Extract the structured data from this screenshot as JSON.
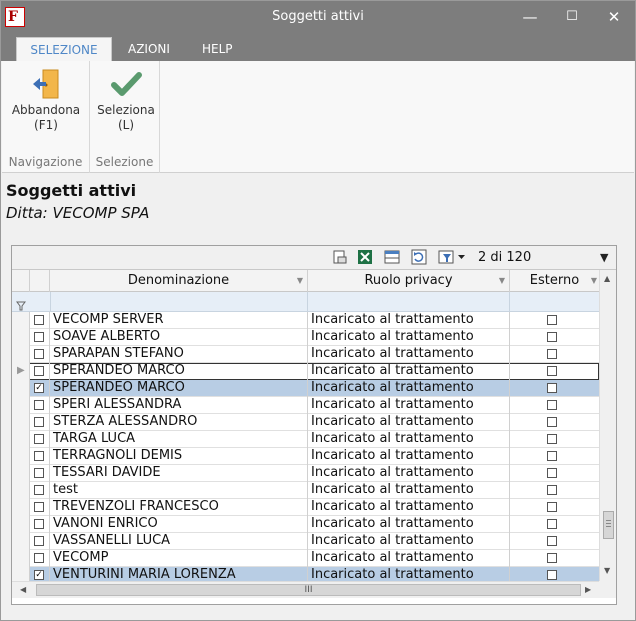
{
  "window": {
    "title": "Soggetti attivi",
    "app_icon": "F",
    "minimize": "—",
    "maximize": "☐",
    "close": "✕"
  },
  "ribbon": {
    "tabs": [
      {
        "label": "SELEZIONE"
      },
      {
        "label": "AZIONI"
      },
      {
        "label": "HELP"
      }
    ],
    "groups": [
      {
        "label": "Navigazione",
        "button": {
          "line1": "Abbandona",
          "line2": "(F1)",
          "icon": "exit-door-icon"
        }
      },
      {
        "label": "Selezione",
        "button": {
          "line1": "Seleziona",
          "line2": "(L)",
          "icon": "checkmark-icon"
        }
      }
    ]
  },
  "page": {
    "title": "Soggetti attivi",
    "subtitle": "Ditta: VECOMP SPA"
  },
  "grid": {
    "pager": "2 di 120",
    "toolbar_icons": [
      "print-preview-icon",
      "excel-export-icon",
      "columns-icon",
      "refresh-icon",
      "filter-settings-icon"
    ],
    "columns": [
      {
        "label": "Denominazione"
      },
      {
        "label": "Ruolo privacy"
      },
      {
        "label": "Esterno"
      }
    ],
    "rows": [
      {
        "name": "VECOMP SERVER",
        "role": "Incaricato al trattamento",
        "checked": false,
        "selected": false,
        "current": false
      },
      {
        "name": "SOAVE ALBERTO",
        "role": "Incaricato al trattamento",
        "checked": false,
        "selected": false,
        "current": false
      },
      {
        "name": "SPARAPAN STEFANO",
        "role": "Incaricato al trattamento",
        "checked": false,
        "selected": false,
        "current": false
      },
      {
        "name": "SPERANDEO MARCO",
        "role": "Incaricato al trattamento",
        "checked": false,
        "selected": false,
        "current": true
      },
      {
        "name": "SPERANDEO MARCO",
        "role": "Incaricato al trattamento",
        "checked": true,
        "selected": true,
        "current": false
      },
      {
        "name": "SPERI ALESSANDRA",
        "role": "Incaricato al trattamento",
        "checked": false,
        "selected": false,
        "current": false
      },
      {
        "name": "STERZA ALESSANDRO",
        "role": "Incaricato al trattamento",
        "checked": false,
        "selected": false,
        "current": false
      },
      {
        "name": "TARGA LUCA",
        "role": "Incaricato al trattamento",
        "checked": false,
        "selected": false,
        "current": false
      },
      {
        "name": "TERRAGNOLI DEMIS",
        "role": "Incaricato al trattamento",
        "checked": false,
        "selected": false,
        "current": false
      },
      {
        "name": "TESSARI DAVIDE",
        "role": "Incaricato al trattamento",
        "checked": false,
        "selected": false,
        "current": false
      },
      {
        "name": "test",
        "role": "Incaricato al trattamento",
        "checked": false,
        "selected": false,
        "current": false
      },
      {
        "name": "TREVENZOLI FRANCESCO",
        "role": "Incaricato al trattamento",
        "checked": false,
        "selected": false,
        "current": false
      },
      {
        "name": "VANONI ENRICO",
        "role": "Incaricato al trattamento",
        "checked": false,
        "selected": false,
        "current": false
      },
      {
        "name": "VASSANELLI LUCA",
        "role": "Incaricato al trattamento",
        "checked": false,
        "selected": false,
        "current": false
      },
      {
        "name": "VECOMP",
        "role": "Incaricato al trattamento",
        "checked": false,
        "selected": false,
        "current": false
      },
      {
        "name": "VENTURINI MARIA LORENZA",
        "role": "Incaricato al trattamento",
        "checked": true,
        "selected": true,
        "current": false
      }
    ],
    "hscroll_grip": "III"
  }
}
